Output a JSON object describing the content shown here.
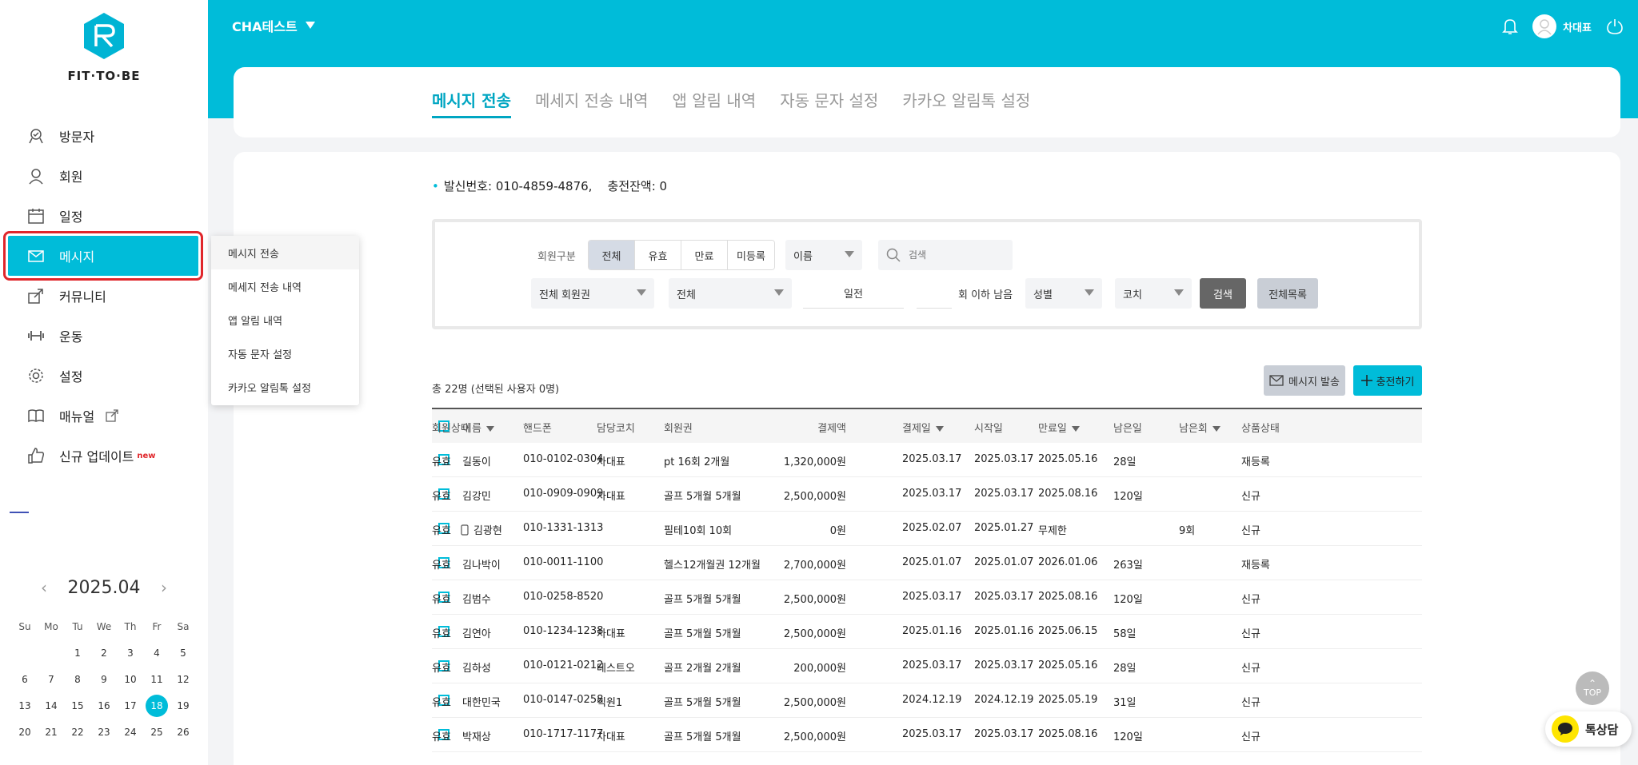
{
  "brand": {
    "logo_text": "FIT·TO·BE"
  },
  "header": {
    "gym_name": "CHA테스트",
    "user_name": "차대표"
  },
  "sidebar": {
    "items": [
      {
        "label": "방문자",
        "icon": "visitor-icon"
      },
      {
        "label": "회원",
        "icon": "member-icon"
      },
      {
        "label": "일정",
        "icon": "calendar-icon"
      },
      {
        "label": "메시지",
        "icon": "mail-icon",
        "active": true
      },
      {
        "label": "커뮤니티",
        "icon": "share-icon"
      },
      {
        "label": "운동",
        "icon": "dumbbell-icon"
      },
      {
        "label": "설정",
        "icon": "gear-icon"
      },
      {
        "label": "매뉴얼",
        "icon": "book-icon"
      },
      {
        "label": "신규 업데이트",
        "icon": "thumbs-up-icon",
        "badge": "new"
      }
    ]
  },
  "submenu": [
    "메시지 전송",
    "메세지 전송 내역",
    "앱 알림 내역",
    "자동 문자 설정",
    "카카오 알림톡 설정"
  ],
  "calendar": {
    "title": "2025.04",
    "dow": [
      "Su",
      "Mo",
      "Tu",
      "We",
      "Th",
      "Fr",
      "Sa"
    ],
    "weeks": [
      [
        "",
        "",
        "1",
        "2",
        "3",
        "4",
        "5"
      ],
      [
        "6",
        "7",
        "8",
        "9",
        "10",
        "11",
        "12"
      ],
      [
        "13",
        "14",
        "15",
        "16",
        "17",
        "18",
        "19"
      ],
      [
        "20",
        "21",
        "22",
        "23",
        "24",
        "25",
        "26"
      ]
    ],
    "today": "18"
  },
  "tabs": [
    "메시지 전송",
    "메세지 전송 내역",
    "앱 알림 내역",
    "자동 문자 설정",
    "카카오 알림톡 설정"
  ],
  "sender_info": "발신번호: 010-4859-4876,    충전잔액: 0",
  "filter": {
    "member_type_label": "회원구분",
    "segments": [
      "전체",
      "유효",
      "만료",
      "미등록"
    ],
    "name_select": "이름",
    "search_placeholder": "검색",
    "pass_select": "전체 회원권",
    "all_select": "전체",
    "days_label": "일전",
    "times_label": "회 이하 남음",
    "gender_select": "성별",
    "coach_select": "코치",
    "search_btn": "검색",
    "all_list_btn": "전체목록"
  },
  "list": {
    "total": "총 22명 (선택된 사용자 0명)",
    "send_btn": "메시지 발송",
    "charge_btn": "충전하기",
    "headers": [
      "회원상태",
      "이름",
      "핸드폰",
      "담당코치",
      "회원권",
      "결제액",
      "결제일",
      "시작일",
      "만료일",
      "남은일",
      "남은회",
      "상품상태"
    ],
    "rows": [
      [
        "유효",
        "길동이",
        "010-0102-0304",
        "차대표",
        "pt 16회 2개월",
        "1,320,000원",
        "2025.03.17",
        "2025.03.17",
        "2025.05.16",
        "28일",
        "",
        "재등록"
      ],
      [
        "유효",
        "김강민",
        "010-0909-0909",
        "차대표",
        "골프 5개월 5개월",
        "2,500,000원",
        "2025.03.17",
        "2025.03.17",
        "2025.08.16",
        "120일",
        "",
        "신규"
      ],
      [
        "유효",
        "김광현",
        "010-1331-1313",
        "",
        "필테10회 10회",
        "0원",
        "2025.02.07",
        "2025.01.27",
        "무제한",
        "",
        "9회",
        "신규"
      ],
      [
        "유효",
        "김나박이",
        "010-0011-1100",
        "",
        "헬스12개월권 12개월",
        "2,700,000원",
        "2025.01.07",
        "2025.01.07",
        "2026.01.06",
        "263일",
        "",
        "재등록"
      ],
      [
        "유효",
        "김범수",
        "010-0258-8520",
        "",
        "골프 5개월 5개월",
        "2,500,000원",
        "2025.03.17",
        "2025.03.17",
        "2025.08.16",
        "120일",
        "",
        "신규"
      ],
      [
        "유효",
        "김연아",
        "010-1234-1238",
        "차대표",
        "골프 5개월 5개월",
        "2,500,000원",
        "2025.01.16",
        "2025.01.16",
        "2025.06.15",
        "58일",
        "",
        "신규"
      ],
      [
        "유효",
        "김하성",
        "010-0121-0212",
        "테스트오",
        "골프 2개월 2개월",
        "200,000원",
        "2025.03.17",
        "2025.03.17",
        "2025.05.16",
        "28일",
        "",
        "신규"
      ],
      [
        "유효",
        "대한민국",
        "010-0147-0258",
        "직원1",
        "골프 5개월 5개월",
        "2,500,000원",
        "2024.12.19",
        "2024.12.19",
        "2025.05.19",
        "31일",
        "",
        "신규"
      ],
      [
        "유효",
        "박재상",
        "010-1717-1177",
        "차대표",
        "골프 5개월 5개월",
        "2,500,000원",
        "2025.03.17",
        "2025.03.17",
        "2025.08.16",
        "120일",
        "",
        "신규"
      ]
    ]
  },
  "floating": {
    "top": "TOP",
    "talk": "톡상담"
  },
  "colors": {
    "accent": "#00bcd9",
    "highlight": "#e0262b"
  }
}
